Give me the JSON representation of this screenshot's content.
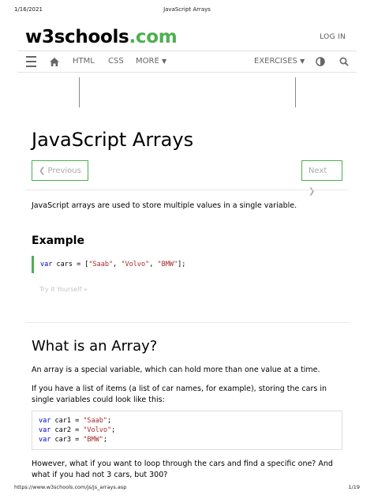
{
  "print_header": {
    "date": "1/16/2021",
    "title": "JavaScript Arrays"
  },
  "site": {
    "logo_main": "w3schools",
    "logo_dot": ".",
    "logo_ext": "com",
    "login": "LOG IN"
  },
  "nav": {
    "html": "HTML",
    "css": "CSS",
    "more": "MORE",
    "exercises": "EXERCISES",
    "icons": [
      "menu-icon",
      "home-icon",
      "contrast-icon",
      "search-icon"
    ]
  },
  "page": {
    "title": "JavaScript Arrays",
    "prev": "❮ Previous",
    "next": "Next ❯",
    "intro": "JavaScript arrays are used to store multiple values in a single variable.",
    "example_heading": "Example",
    "try_it": "Try it Yourself »",
    "section_heading": "What is an Array?",
    "para1": "An array is a special variable, which can hold more than one value at a time.",
    "para2": "If you have a list of items (a list of car names, for example), storing the cars in single variables could look like this:",
    "para3": "However, what if you want to loop through the cars and find a specific one? And what if you had not 3 cars, but 300?"
  },
  "code": {
    "kw_var": "var",
    "example": {
      "name": "cars = [",
      "s1": "\"Saab\"",
      "s2": "\"Volvo\"",
      "s3": "\"BMW\"",
      "sep": ", ",
      "end": "];"
    },
    "car1_name": "car1 = ",
    "car1_val": "\"Saab\"",
    "car2_name": "car2 = ",
    "car2_val": "\"Volvo\"",
    "car3_name": "car3 = ",
    "car3_val": "\"BMW\"",
    "semi": ";"
  },
  "print_footer": {
    "url": "https://www.w3schools.com/js/js_arrays.asp",
    "page": "1/19"
  },
  "colors": {
    "accent": "#4CAF50",
    "keyword": "#0000cd",
    "string": "#a52a2a"
  }
}
